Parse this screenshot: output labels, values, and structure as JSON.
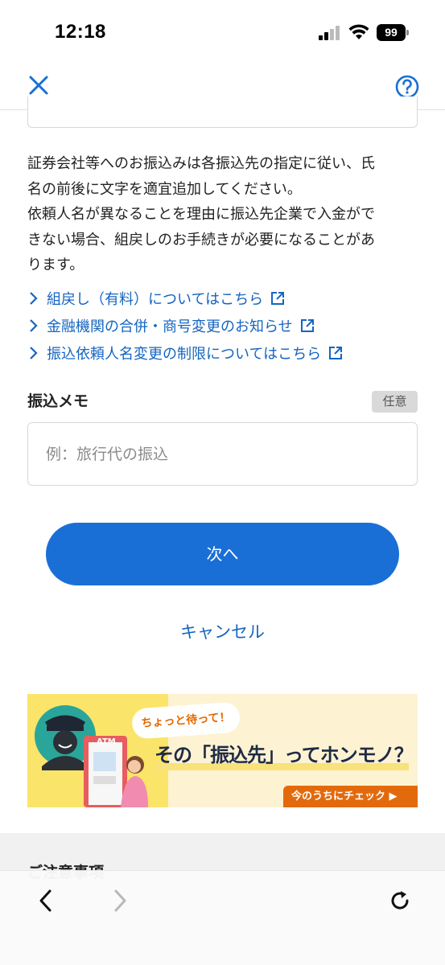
{
  "status_bar": {
    "time": "12:18",
    "battery": "99"
  },
  "header": {
    "close_icon": "close-icon",
    "help_icon": "help-icon"
  },
  "notice": {
    "lines": [
      "証券会社等へのお振込みは各振込先の指定に従い、氏",
      "名の前後に文字を適宜追加してください。",
      "依頼人名が異なることを理由に振込先企業で入金がで",
      "きない場合、組戻しのお手続きが必要になることがあ",
      "ります。"
    ]
  },
  "links": [
    {
      "label": "組戻し（有料）についてはこちら"
    },
    {
      "label": "金融機関の合併・商号変更のお知らせ"
    },
    {
      "label": "振込依頼人名変更の制限についてはこちら"
    }
  ],
  "memo": {
    "label": "振込メモ",
    "badge": "任意",
    "placeholder": "例：旅行代の振込",
    "value": ""
  },
  "actions": {
    "next_label": "次へ",
    "cancel_label": "キャンセル"
  },
  "banner": {
    "speech": "ちょっと待って！",
    "headline": "その「振込先」ってホンモノ？",
    "badge": "今のうちにチェック ▶",
    "atm_label": "ATM"
  },
  "notes": {
    "title": "ご注意事項"
  },
  "colors": {
    "accent": "#1a6fd6",
    "link": "#1565c0",
    "banner_yellow": "#fbe46a",
    "banner_orange": "#e36a0c"
  }
}
